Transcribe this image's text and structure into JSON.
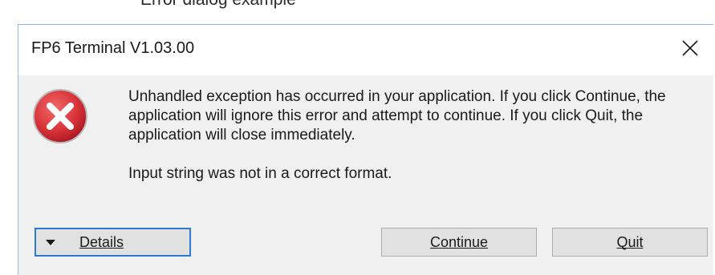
{
  "caption": "Error dialog example",
  "dialog": {
    "title": "FP6 Terminal V1.03.00",
    "close_icon": "close-icon",
    "error_icon": "error-x-circle-icon",
    "message": "Unhandled exception has occurred in your application. If you click Continue, the application will ignore this error and attempt to continue. If you click Quit, the application will close immediately.",
    "detail": "Input string was not in a correct format.",
    "buttons": {
      "details_label": "Details",
      "continue_label": "Continue",
      "quit_label": "Quit"
    },
    "colors": {
      "error_red": "#d9343a",
      "focus_border": "#2a7ad6",
      "dialog_bg": "#f0f0f0",
      "button_bg": "#e1e1e1"
    }
  }
}
